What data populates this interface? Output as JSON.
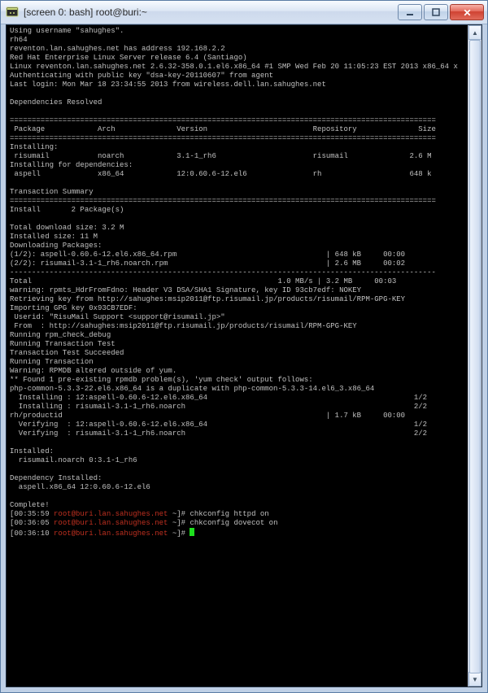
{
  "window": {
    "title": "[screen 0: bash] root@buri:~"
  },
  "term": {
    "l0": "Using username \"sahughes\".",
    "l1": "rh64",
    "l2": "reventon.lan.sahughes.net has address 192.168.2.2",
    "l3": "Red Hat Enterprise Linux Server release 6.4 (Santiago)",
    "l4": "Linux reventon.lan.sahughes.net 2.6.32-358.0.1.el6.x86_64 #1 SMP Wed Feb 20 11:05:23 EST 2013 x86_64 x",
    "l5": "Authenticating with public key \"dsa-key-20110607\" from agent",
    "l6": "Last login: Mon Mar 18 23:34:55 2013 from wireless.dell.lan.sahughes.net",
    "l8": "Dependencies Resolved",
    "sep1": "=================================================================================================",
    "hdr": " Package            Arch              Version                        Repository              Size",
    "sep2": "=================================================================================================",
    "inst": "Installing:",
    "r1": " risumail           noarch            3.1-1_rh6                      risumail              2.6 M",
    "instd": "Installing for dependencies:",
    "r2": " aspell             x86_64            12:0.60.6-12.el6               rh                    648 k",
    "ts": "Transaction Summary",
    "sep3": "=================================================================================================",
    "ins2": "Install       2 Package(s)",
    "tds": "Total download size: 3.2 M",
    "isz": "Installed size: 11 M",
    "dlp": "Downloading Packages:",
    "d1": "(1/2): aspell-0.60.6-12.el6.x86_64.rpm                                  | 648 kB     00:00",
    "d2": "(2/2): risumail-3.1-1_rh6.noarch.rpm                                    | 2.6 MB     00:02",
    "dash": "-------------------------------------------------------------------------------------------------",
    "tot": "Total                                                        1.0 MB/s | 3.2 MB     00:03",
    "w1": "warning: rpmts_HdrFromFdno: Header V3 DSA/SHA1 Signature, key ID 93cb7edf: NOKEY",
    "w2": "Retrieving key from http://sahughes:msip2011@ftp.risumail.jp/products/risumail/RPM-GPG-KEY",
    "w3": "Importing GPG key 0x93CB7EDF:",
    "w4": " Userid: \"RisuMail Support <support@risumail.jp>\"",
    "w5": " From  : http://sahughes:msip2011@ftp.risumail.jp/products/risumail/RPM-GPG-KEY",
    "w6": "Running rpm_check_debug",
    "w7": "Running Transaction Test",
    "w8": "Transaction Test Succeeded",
    "w9": "Running Transaction",
    "w10": "Warning: RPMDB altered outside of yum.",
    "w11": "** Found 1 pre-existing rpmdb problem(s), 'yum check' output follows:",
    "w12": "php-common-5.3.3-22.el6.x86_64 is a duplicate with php-common-5.3.3-14.el6_3.x86_64",
    "i1": "  Installing : 12:aspell-0.60.6-12.el6.x86_64                                               1/2",
    "i2": "  Installing : risumail-3.1-1_rh6.noarch                                                    2/2",
    "pid": "rh/productid                                                            | 1.7 kB     00:00",
    "v1": "  Verifying  : 12:aspell-0.60.6-12.el6.x86_64                                               1/2",
    "v2": "  Verifying  : risumail-3.1-1_rh6.noarch                                                    2/2",
    "ih": "Installed:",
    "ip": "  risumail.noarch 0:3.1-1_rh6",
    "dh": "Dependency Installed:",
    "dp": "  aspell.x86_64 12:0.60.6-12.el6",
    "cp": "Complete!",
    "p1t": "[00:35:59 ",
    "p1h": "root@buri.lan.sahughes.net",
    "p1e": " ~]# ",
    "c1": "chkconfig httpd on",
    "p2t": "[00:36:05 ",
    "c2": "chkconfig dovecot on",
    "p3t": "[00:36:10 "
  }
}
